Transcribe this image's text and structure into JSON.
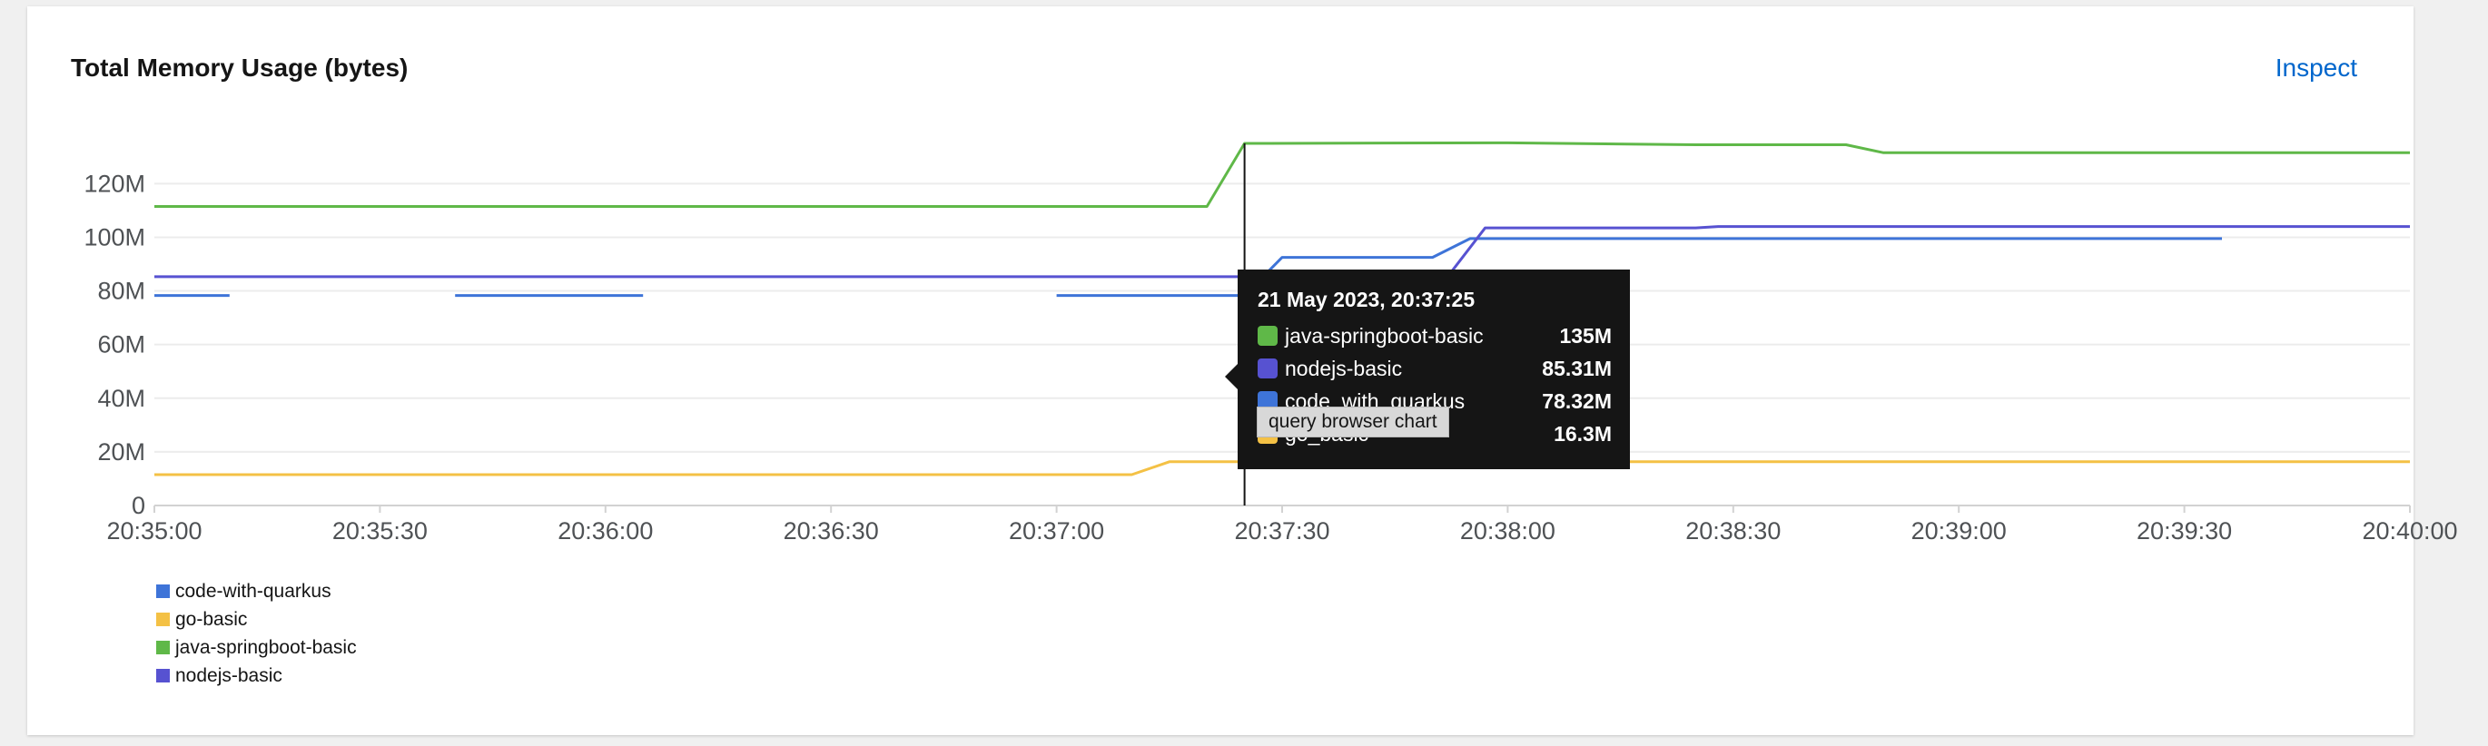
{
  "card": {
    "title": "Total Memory Usage (bytes)",
    "inspect_label": "Inspect"
  },
  "colors": {
    "code-with-quarkus": "#3e74d8",
    "go-basic": "#f4c145",
    "java-springboot-basic": "#5fb848",
    "nodejs-basic": "#5752d1",
    "link": "#0066cc",
    "tooltip_bg": "#151515"
  },
  "chart_data": {
    "type": "line",
    "title": "Total Memory Usage (bytes)",
    "x_unit": "time (HH:MM:SS)",
    "xlim": [
      "20:35:00",
      "20:40:00"
    ],
    "ylim": [
      0,
      135000000
    ],
    "x_ticks": [
      "20:35:00",
      "20:35:30",
      "20:36:00",
      "20:36:30",
      "20:37:00",
      "20:37:30",
      "20:38:00",
      "20:38:30",
      "20:39:00",
      "20:39:30",
      "20:40:00"
    ],
    "y_ticks": [
      {
        "value": 0,
        "label": "0"
      },
      {
        "value": 20000000,
        "label": "20M"
      },
      {
        "value": 40000000,
        "label": "40M"
      },
      {
        "value": 60000000,
        "label": "60M"
      },
      {
        "value": 80000000,
        "label": "80M"
      },
      {
        "value": 100000000,
        "label": "100M"
      },
      {
        "value": 120000000,
        "label": "120M"
      }
    ],
    "grid": true,
    "legend_position": "bottom-left",
    "series": [
      {
        "name": "java-springboot-basic",
        "segments": [
          [
            [
              "20:35:00",
              111500000
            ],
            [
              "20:37:20",
              111500000
            ],
            [
              "20:37:25",
              135000000
            ],
            [
              "20:38:00",
              135200000
            ],
            [
              "20:38:25",
              134500000
            ],
            [
              "20:38:45",
              134500000
            ],
            [
              "20:38:50",
              131500000
            ],
            [
              "20:40:00",
              131500000
            ]
          ]
        ]
      },
      {
        "name": "nodejs-basic",
        "segments": [
          [
            [
              "20:35:00",
              85300000
            ],
            [
              "20:37:25",
              85300000
            ],
            [
              "20:37:52",
              85300000
            ],
            [
              "20:37:57",
              103500000
            ],
            [
              "20:38:25",
              103500000
            ],
            [
              "20:38:28",
              104000000
            ],
            [
              "20:40:00",
              104000000
            ]
          ]
        ]
      },
      {
        "name": "code-with-quarkus",
        "segments": [
          [
            [
              "20:35:00",
              78300000
            ],
            [
              "20:35:10",
              78300000
            ]
          ],
          [
            [
              "20:35:40",
              78300000
            ],
            [
              "20:36:05",
              78300000
            ]
          ],
          [
            [
              "20:37:00",
              78300000
            ],
            [
              "20:37:25",
              78300000
            ],
            [
              "20:37:30",
              92500000
            ],
            [
              "20:37:50",
              92500000
            ],
            [
              "20:37:55",
              99500000
            ],
            [
              "20:39:35",
              99500000
            ]
          ]
        ]
      },
      {
        "name": "go-basic",
        "segments": [
          [
            [
              "20:35:00",
              11500000
            ],
            [
              "20:37:10",
              11500000
            ],
            [
              "20:37:15",
              16300000
            ],
            [
              "20:40:00",
              16300000
            ]
          ]
        ]
      }
    ],
    "legend": [
      "code-with-quarkus",
      "go-basic",
      "java-springboot-basic",
      "nodejs-basic"
    ],
    "hover_time": "20:37:25"
  },
  "tooltip": {
    "title": "21 May 2023, 20:37:25",
    "rows": [
      {
        "name": "java-springboot-basic",
        "value": "135M",
        "color": "#5fb848"
      },
      {
        "name": "nodejs-basic",
        "value": "85.31M",
        "color": "#5752d1"
      },
      {
        "name": "code_with_quarkus",
        "value": "78.32M",
        "color": "#3e74d8"
      },
      {
        "name": "go_basic",
        "value": "16.3M",
        "color": "#f4c145"
      }
    ]
  },
  "svg_title": "query browser chart"
}
